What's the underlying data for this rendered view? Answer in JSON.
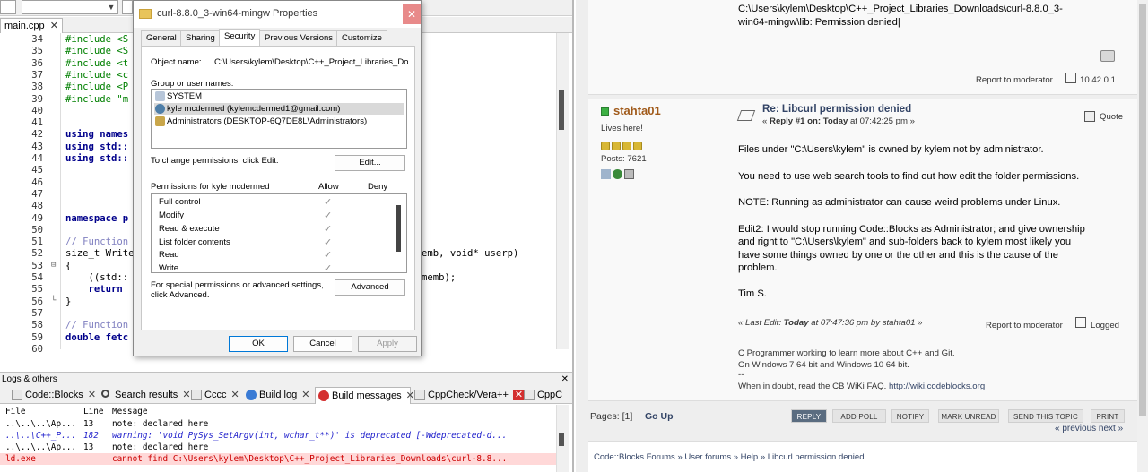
{
  "ide": {
    "editor_tab": "main.cpp",
    "close_glyph": "✕",
    "line_numbers": [
      "34",
      "35",
      "36",
      "37",
      "38",
      "39",
      "40",
      "41",
      "42",
      "43",
      "44",
      "45",
      "46",
      "47",
      "48",
      "49",
      "50",
      "51",
      "52",
      "53",
      "54",
      "55",
      "56",
      "57",
      "58",
      "59",
      "60"
    ],
    "code_lines": [
      {
        "n": "34",
        "text": "#include <S",
        "cls": "pp"
      },
      {
        "n": "35",
        "text": "#include <S",
        "cls": "pp"
      },
      {
        "n": "36",
        "text": "#include <t",
        "cls": "pp"
      },
      {
        "n": "37",
        "text": "#include <c",
        "cls": "pp"
      },
      {
        "n": "38",
        "text": "#include <P",
        "cls": "pp"
      },
      {
        "n": "39",
        "text": "#include \"m",
        "cls": "pp"
      },
      {
        "n": "42",
        "text": "using names",
        "cls": "kw"
      },
      {
        "n": "43",
        "text": "using std::",
        "cls": "kw"
      },
      {
        "n": "44",
        "text": "using std::",
        "cls": "kw"
      },
      {
        "n": "49",
        "text": "namespace p",
        "cls": "kw"
      },
      {
        "n": "51",
        "text": "// Function",
        "cls": "cm"
      },
      {
        "n": "52",
        "text": "size_t Write",
        "cls": ""
      },
      {
        "n": "53",
        "text": "{",
        "cls": ""
      },
      {
        "n": "54",
        "text": "    ((std::",
        "cls": ""
      },
      {
        "n": "55",
        "text": "    return",
        "cls": "kw"
      },
      {
        "n": "56",
        "text": "}",
        "cls": ""
      },
      {
        "n": "58",
        "text": "// Function",
        "cls": "cm"
      },
      {
        "n": "59",
        "text": "double fetc",
        "cls": "kw"
      }
    ],
    "code_tail_52": "emb, void* userp)",
    "code_tail_54": "memb);",
    "logs_title": "Logs & others",
    "log_tabs": [
      {
        "label": "Code::Blocks"
      },
      {
        "label": "Search results"
      },
      {
        "label": "Cccc"
      },
      {
        "label": "Build log"
      },
      {
        "label": "Build messages"
      },
      {
        "label": "CppCheck/Vera++"
      },
      {
        "label": "CppC"
      }
    ],
    "log_headers": {
      "file": "File",
      "line": "Line",
      "message": "Message"
    },
    "log_rows": [
      {
        "file": "..\\..\\..\\Ap...",
        "line": "13",
        "message": "note: declared here",
        "kind": "note"
      },
      {
        "file": "..\\..\\C++_P...",
        "line": "182",
        "message": "warning: 'void PySys_SetArgv(int, wchar_t**)' is deprecated [-Wdeprecated-d...",
        "kind": "warn"
      },
      {
        "file": "..\\..\\..\\Ap...",
        "line": "13",
        "message": "note: declared here",
        "kind": "note"
      },
      {
        "file": "ld.exe",
        "line": "",
        "message": "cannot find C:\\Users\\kylem\\Desktop\\C++_Project_Libraries_Downloads\\curl-8.8...",
        "kind": "err"
      }
    ]
  },
  "dialog": {
    "title": "curl-8.8.0_3-win64-mingw Properties",
    "tabs": [
      "General",
      "Sharing",
      "Security",
      "Previous Versions",
      "Customize"
    ],
    "active_tab": "Security",
    "object_name_label": "Object name:",
    "object_name_value": "C:\\Users\\kylem\\Desktop\\C++_Project_Libraries_Dowr",
    "group_label": "Group or user names:",
    "users": [
      {
        "name": "SYSTEM",
        "selected": false
      },
      {
        "name": "kyle mcdermed (kylemcdermed1@gmail.com)",
        "selected": true
      },
      {
        "name": "Administrators (DESKTOP-6Q7DE8L\\Administrators)",
        "selected": false
      }
    ],
    "change_perm_text": "To change permissions, click Edit.",
    "edit_button": "Edit...",
    "perm_for_label": "Permissions for kyle mcdermed",
    "allow_label": "Allow",
    "deny_label": "Deny",
    "permissions": [
      {
        "name": "Full control",
        "allow": true
      },
      {
        "name": "Modify",
        "allow": true
      },
      {
        "name": "Read & execute",
        "allow": true
      },
      {
        "name": "List folder contents",
        "allow": true
      },
      {
        "name": "Read",
        "allow": true
      },
      {
        "name": "Write",
        "allow": true
      }
    ],
    "check_glyph": "✓",
    "special_text_1": "For special permissions or advanced settings,",
    "special_text_2": "click Advanced.",
    "advanced_button": "Advanced",
    "ok_button": "OK",
    "cancel_button": "Cancel",
    "apply_button": "Apply",
    "close_glyph": "✕"
  },
  "forum": {
    "prev_post_text_1": "C:\\Users\\kylem\\Desktop\\C++_Project_Libraries_Downloads\\curl-8.8.0_3-",
    "prev_post_text_2": "win64-mingw\\lib: Permission denied|",
    "prev_report": "Report to moderator",
    "prev_ip": "10.42.0.1",
    "author": "stahta01",
    "author_status": "Lives here!",
    "posts_label": "Posts: 7621",
    "post_title": "Re: Libcurl permission denied",
    "reply_prefix": "« ",
    "reply_num": "Reply #1 on:",
    "reply_date": "Today",
    "reply_time": " at 07:42:25 pm »",
    "quote": "Quote",
    "body": [
      "Files under \"C:\\Users\\kylem\" is owned by kylem not by administrator.",
      "You need to use web search tools to find out how edit the folder permissions.",
      "NOTE: Running as administrator can cause weird problems under Linux."
    ],
    "edit2_lines": [
      "Edit2: I would stop running Code::Blocks as Administrator; and give ownership",
      "and right to  \"C:\\Users\\kylem\" and sub-folders back to kylem most likely you",
      "have some things owned by one or the other and this is the cause of the",
      "problem."
    ],
    "signoff": "Tim S.",
    "last_edit_prefix": "« Last Edit: ",
    "last_edit_date": "Today",
    "last_edit_rest": " at 07:47:36 pm by stahta01 »",
    "report": "Report to moderator",
    "logged": "Logged",
    "sig": [
      "C Programmer working to learn more about C++ and Git.",
      "On Windows 7 64 bit and Windows 10 64 bit.",
      "--",
      "When in doubt, read the CB WiKi FAQ. "
    ],
    "sig_link": "http://wiki.codeblocks.org",
    "pages": "Pages: [1]",
    "go_up": "Go Up",
    "buttons": [
      "REPLY",
      "ADD POLL",
      "NOTIFY",
      "MARK UNREAD",
      "SEND THIS TOPIC",
      "PRINT"
    ],
    "prev_next": "« previous next »",
    "breadcrumb": "Code::Blocks Forums » User forums » Help » Libcurl permission denied"
  }
}
